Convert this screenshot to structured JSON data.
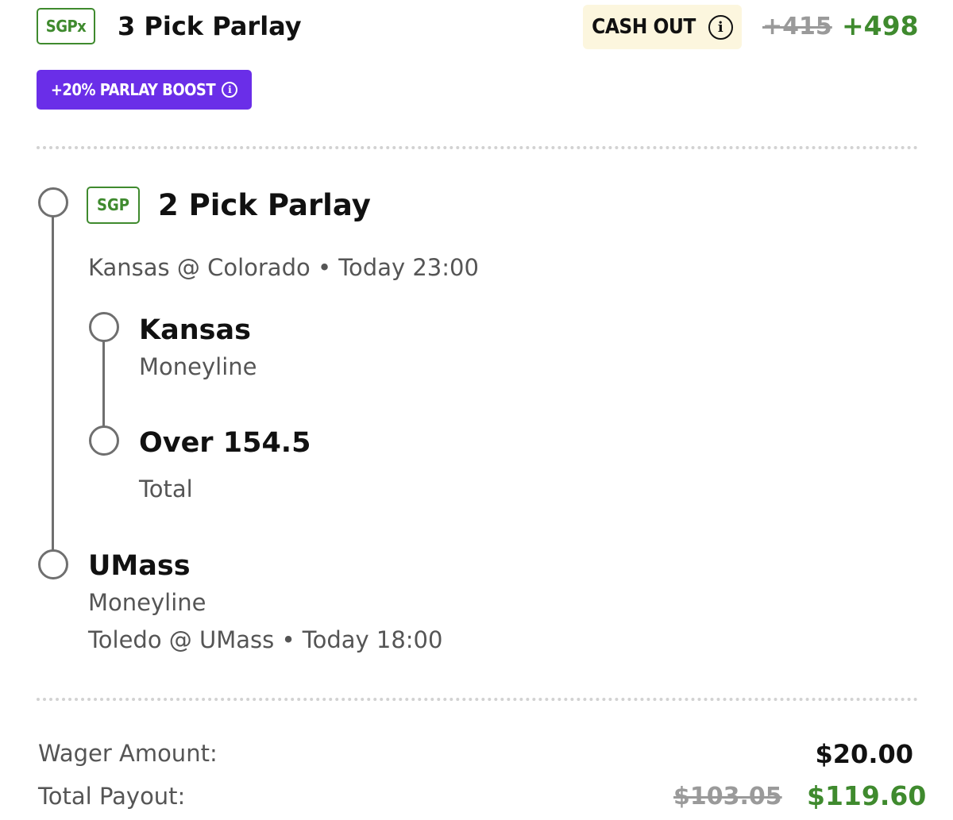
{
  "colors": {
    "accent_green": "#3f8a2e",
    "boost_purple": "#6a2ee8",
    "cashout_bg": "#fcf6de",
    "muted_text": "#555555",
    "strike_gray": "#9a9a9a"
  },
  "header": {
    "badge": "SGPx",
    "title": "3 Pick Parlay",
    "cashout_label": "CASH OUT",
    "cashout_icon": "info-icon",
    "old_odds": "+415",
    "new_odds": "+498",
    "boost_label": "+20% PARLAY BOOST",
    "boost_icon": "info-icon"
  },
  "sgp": {
    "badge": "SGP",
    "title": "2 Pick Parlay",
    "matchup": "Kansas @ Colorado • Today 23:00",
    "legs": [
      {
        "name": "Kansas",
        "type": "Moneyline"
      },
      {
        "name": "Over 154.5",
        "type": "Total"
      }
    ]
  },
  "single_leg": {
    "name": "UMass",
    "type": "Moneyline",
    "matchup": "Toledo @ UMass • Today 18:00"
  },
  "footer": {
    "wager_label": "Wager Amount:",
    "wager_value": "$20.00",
    "payout_label": "Total Payout:",
    "old_payout": "$103.05",
    "new_payout": "$119.60"
  }
}
